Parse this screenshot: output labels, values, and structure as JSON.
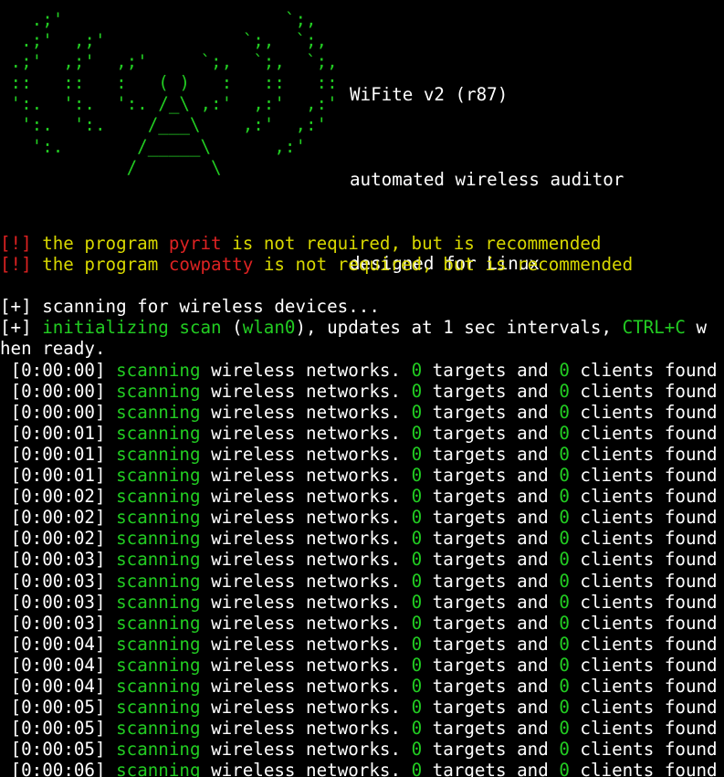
{
  "colors": {
    "background": "#000000",
    "text": "#ffffff",
    "green": "#22cc22",
    "red": "#dd2222",
    "yellow": "#d8d800"
  },
  "banner": {
    "ascii_green": [
      "   .;'                     `;,    ",
      "  .;'  ,;'             `;,  `;,   ",
      " .;'  ,;'  ,;'     `;,  `;,  `;,  ",
      " ::   ::   :   ( )   :   ::   ::  ",
      " ':.  ':.  ':. /_\\ ,:'  ,:'  ,:'  ",
      "  ':.  ':.    /___\\    ,:'  ,:'   ",
      "   ':.       /_____\\      ,:'     ",
      "            /       \\             "
    ],
    "title": "WiFite v2 (r87)",
    "subtitle": "automated wireless auditor",
    "platform": "designed for Linux"
  },
  "warnings": [
    {
      "tag": "[!]",
      "pre": " the program ",
      "prog": "pyrit",
      "post": " is not required, but is recommended"
    },
    {
      "tag": "[!]",
      "pre": " the program ",
      "prog": "cowpatty",
      "post": " is not required, but is recommended"
    }
  ],
  "info": {
    "scan_tag": "[+]",
    "scan_text": " scanning for wireless devices...",
    "init_tag": "[+]",
    "init_green": " initializing scan",
    "init_paren_open": " (",
    "init_iface": "wlan0",
    "init_rest": "), updates at 1 sec intervals, ",
    "init_key": "CTRL+C",
    "init_tail": " w",
    "wrap": "hen ready."
  },
  "scan_line": {
    "word": "scanning",
    "networks": " wireless networks. ",
    "targets_label": " targets and ",
    "clients_label": " clients found"
  },
  "scan_log": [
    {
      "time": "[0:00:00]",
      "targets": "0",
      "clients": "0"
    },
    {
      "time": "[0:00:00]",
      "targets": "0",
      "clients": "0"
    },
    {
      "time": "[0:00:00]",
      "targets": "0",
      "clients": "0"
    },
    {
      "time": "[0:00:01]",
      "targets": "0",
      "clients": "0"
    },
    {
      "time": "[0:00:01]",
      "targets": "0",
      "clients": "0"
    },
    {
      "time": "[0:00:01]",
      "targets": "0",
      "clients": "0"
    },
    {
      "time": "[0:00:02]",
      "targets": "0",
      "clients": "0"
    },
    {
      "time": "[0:00:02]",
      "targets": "0",
      "clients": "0"
    },
    {
      "time": "[0:00:02]",
      "targets": "0",
      "clients": "0"
    },
    {
      "time": "[0:00:03]",
      "targets": "0",
      "clients": "0"
    },
    {
      "time": "[0:00:03]",
      "targets": "0",
      "clients": "0"
    },
    {
      "time": "[0:00:03]",
      "targets": "0",
      "clients": "0"
    },
    {
      "time": "[0:00:03]",
      "targets": "0",
      "clients": "0"
    },
    {
      "time": "[0:00:04]",
      "targets": "0",
      "clients": "0"
    },
    {
      "time": "[0:00:04]",
      "targets": "0",
      "clients": "0"
    },
    {
      "time": "[0:00:04]",
      "targets": "0",
      "clients": "0"
    },
    {
      "time": "[0:00:05]",
      "targets": "0",
      "clients": "0"
    },
    {
      "time": "[0:00:05]",
      "targets": "0",
      "clients": "0"
    },
    {
      "time": "[0:00:05]",
      "targets": "0",
      "clients": "0"
    },
    {
      "time": "[0:00:06]",
      "targets": "0",
      "clients": "0"
    }
  ]
}
